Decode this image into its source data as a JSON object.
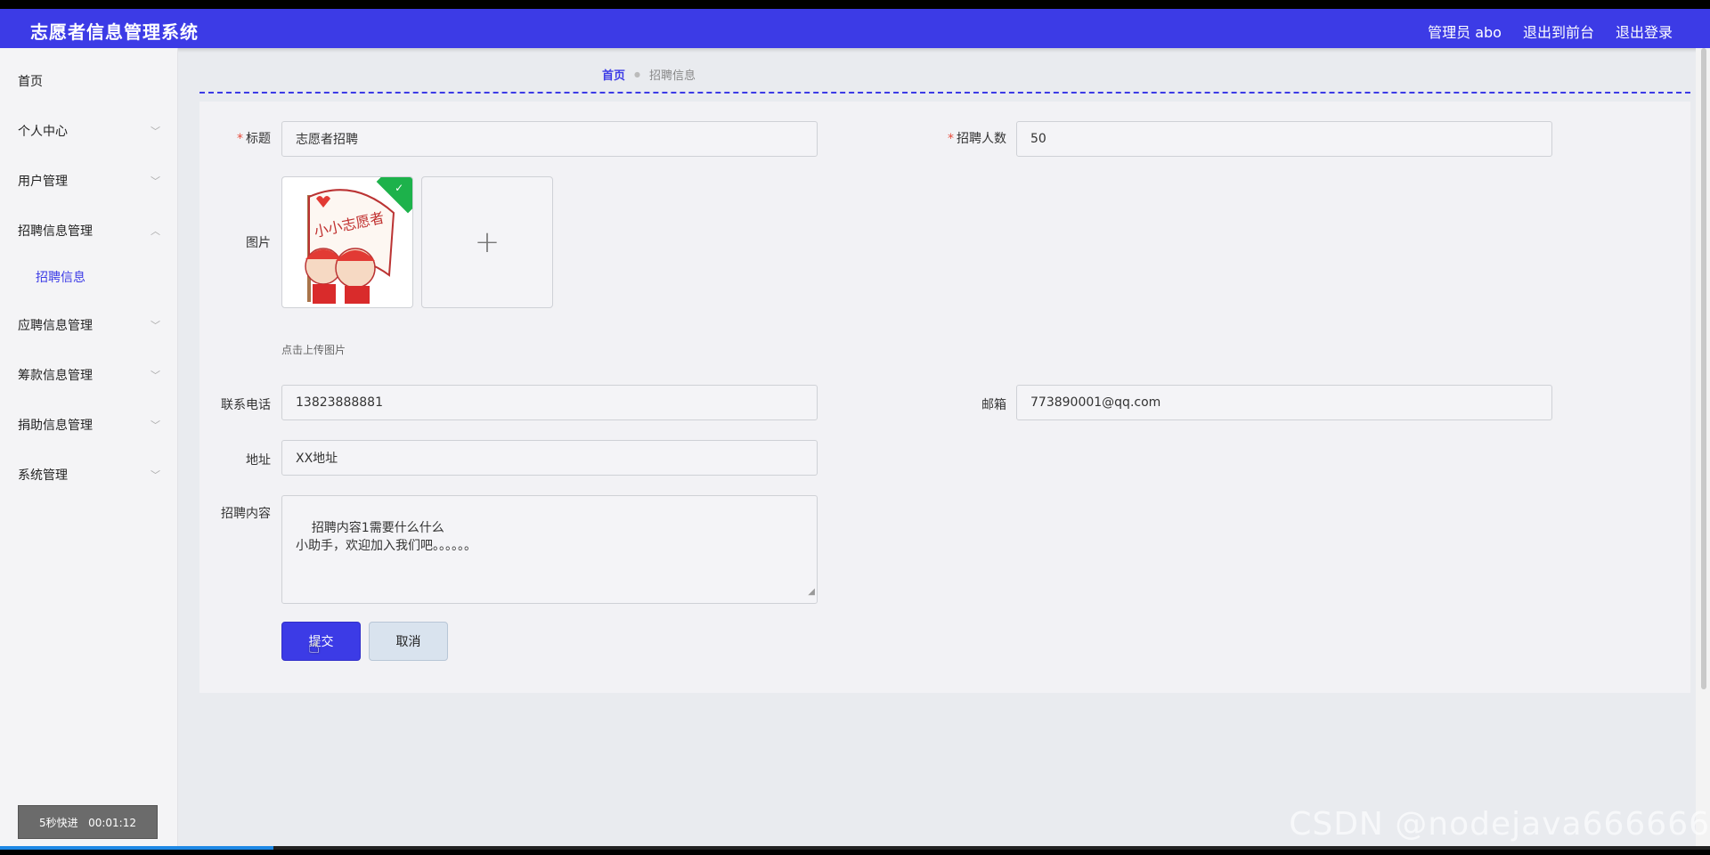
{
  "header": {
    "title": "志愿者信息管理系统",
    "links": [
      "管理员 abo",
      "退出到前台",
      "退出登录"
    ]
  },
  "sidebar": {
    "items": [
      {
        "label": "首页",
        "expandable": false
      },
      {
        "label": "个人中心",
        "expandable": true
      },
      {
        "label": "用户管理",
        "expandable": true
      },
      {
        "label": "招聘信息管理",
        "expandable": true,
        "expanded": true
      },
      {
        "label": "应聘信息管理",
        "expandable": true
      },
      {
        "label": "筹款信息管理",
        "expandable": true
      },
      {
        "label": "捐助信息管理",
        "expandable": true
      },
      {
        "label": "系统管理",
        "expandable": true
      }
    ],
    "submenu": {
      "label": "招聘信息"
    },
    "timer": "5秒快进   00:01:12"
  },
  "breadcrumb": {
    "home": "首页",
    "separator": "●",
    "current": "招聘信息"
  },
  "form": {
    "title_label": "标题",
    "title_value": "志愿者招聘",
    "count_label": "招聘人数",
    "count_value": "50",
    "image_label": "图片",
    "upload_hint": "点击上传图片",
    "add_symbol": "+",
    "phone_label": "联系电话",
    "phone_value": "13823888881",
    "email_label": "邮箱",
    "email_value": "773890001@qq.com",
    "address_label": "地址",
    "address_value": "XX地址",
    "content_label": "招聘内容",
    "content_value": "招聘内容1需要什么什么\n小助手，欢迎加入我们吧。。。。。。",
    "required_mark": "*",
    "submit_label": "提交",
    "cancel_label": "取消"
  },
  "watermark": "CSDN @nodejava666666",
  "progress": {
    "fraction": 0.16
  },
  "colors": {
    "primary": "#3c3be6",
    "success": "#1db24b",
    "required": "#e74c3c"
  }
}
